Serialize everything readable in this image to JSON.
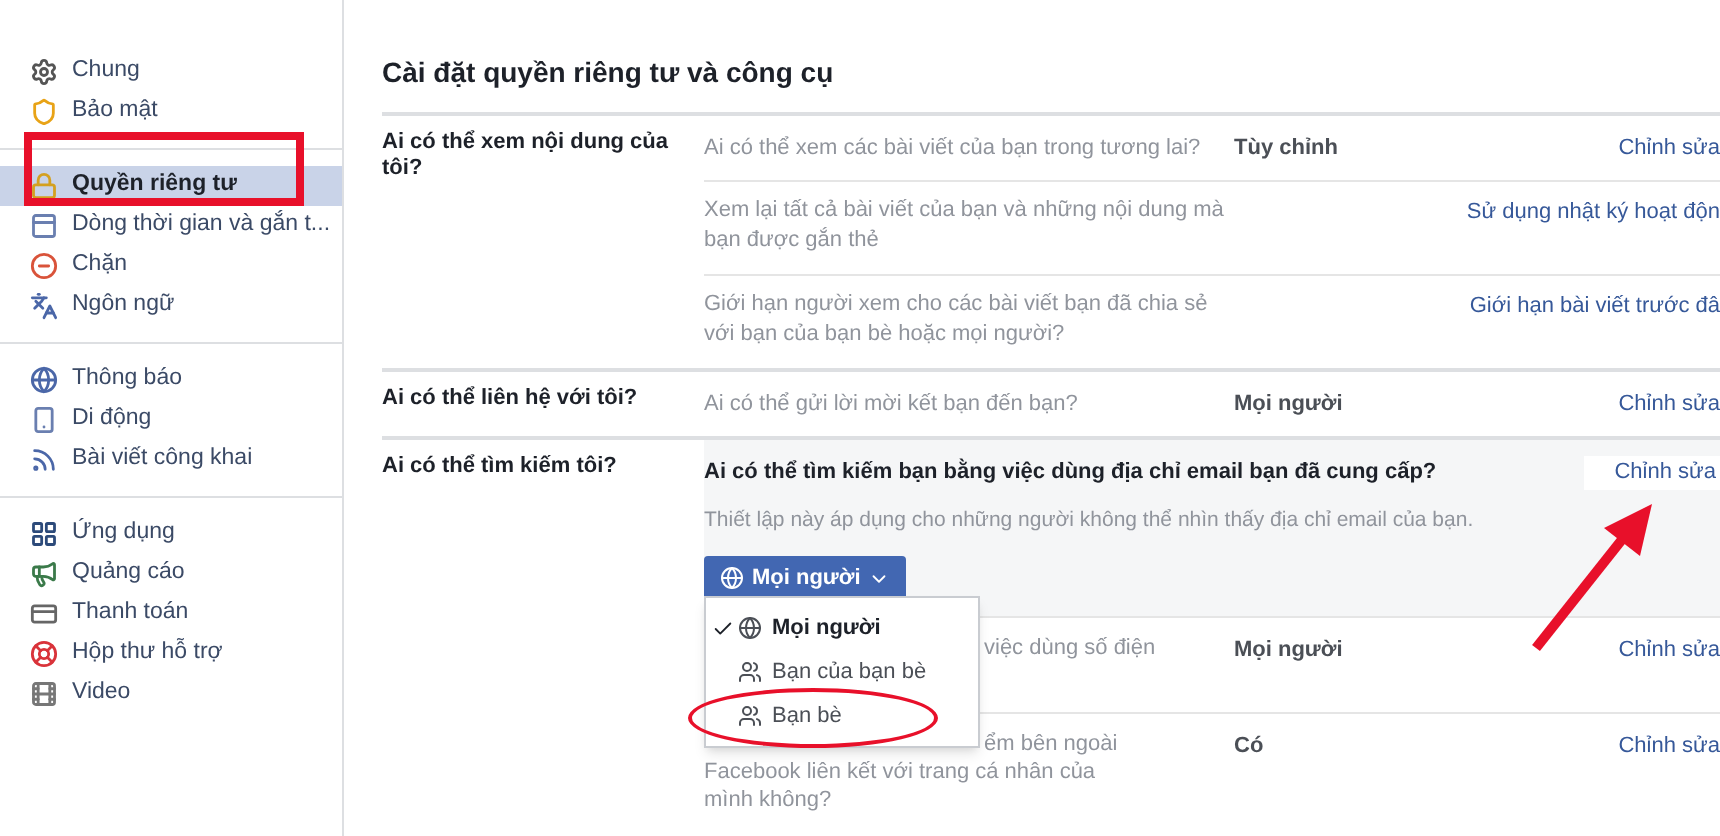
{
  "sidebar": {
    "groups": [
      {
        "items": [
          {
            "label": "Chung",
            "selected": false
          },
          {
            "label": "Bảo mật",
            "selected": false
          }
        ]
      },
      {
        "items": [
          {
            "label": "Quyền riêng tư",
            "selected": true
          },
          {
            "label": "Dòng thời gian và gắn t...",
            "selected": false
          },
          {
            "label": "Chặn",
            "selected": false
          },
          {
            "label": "Ngôn ngữ",
            "selected": false
          }
        ]
      },
      {
        "items": [
          {
            "label": "Thông báo",
            "selected": false
          },
          {
            "label": "Di động",
            "selected": false
          },
          {
            "label": "Bài viết công khai",
            "selected": false
          }
        ]
      },
      {
        "items": [
          {
            "label": "Ứng dụng",
            "selected": false
          },
          {
            "label": "Quảng cáo",
            "selected": false
          },
          {
            "label": "Thanh toán",
            "selected": false
          },
          {
            "label": "Hộp thư hỗ trợ",
            "selected": false
          },
          {
            "label": "Video",
            "selected": false
          }
        ]
      }
    ]
  },
  "title": "Cài đặt quyền riêng tư và công cụ",
  "sections": [
    {
      "label": "Ai có thể xem nội dung của tôi?",
      "rows": [
        {
          "kind": "setting",
          "question": "Ai có thể xem các bài viết của bạn trong tương lai?",
          "value": "Tùy chỉnh",
          "action": "Chỉnh sửa"
        },
        {
          "kind": "link",
          "question": "Xem lại tất cả bài viết của bạn và những nội dung mà bạn được gắn thẻ",
          "action": "Sử dụng nhật ký hoạt độn"
        },
        {
          "kind": "link",
          "question": "Giới hạn người xem cho các bài viết bạn đã chia sẻ với bạn của bạn bè hoặc mọi người?",
          "action": "Giới hạn bài viết trước đâ"
        }
      ]
    },
    {
      "label": "Ai có thể liên hệ với tôi?",
      "rows": [
        {
          "kind": "setting",
          "question": "Ai có thể gửi lời mời kết bạn đến bạn?",
          "value": "Mọi người",
          "action": "Chỉnh sửa"
        }
      ]
    },
    {
      "label": "Ai có thể tìm kiếm tôi?",
      "rows": [
        {
          "kind": "expanded",
          "question": "Ai có thể tìm kiếm bạn bằng việc dùng địa chỉ email bạn đã cung cấp?",
          "note": "Thiết lập này áp dụng cho những người không thể nhìn thấy địa chỉ email của bạn.",
          "button": "Mọi người",
          "action": "Chỉnh sửa",
          "menu": [
            {
              "label": "Mọi người",
              "selected": true,
              "kind": "globe"
            },
            {
              "label": "Bạn của bạn bè",
              "selected": false,
              "kind": "people"
            },
            {
              "label": "Bạn bè",
              "selected": false,
              "kind": "people"
            }
          ]
        },
        {
          "kind": "covered",
          "question": "việc dùng số điện",
          "value": "Mọi người",
          "action": "Chỉnh sửa"
        },
        {
          "kind": "covered",
          "question": "ểm bên ngoài",
          "question_more": "Facebook liên kết với trang cá nhân của mình không?",
          "value": "Có",
          "action": "Chỉnh sửa"
        }
      ]
    }
  ]
}
